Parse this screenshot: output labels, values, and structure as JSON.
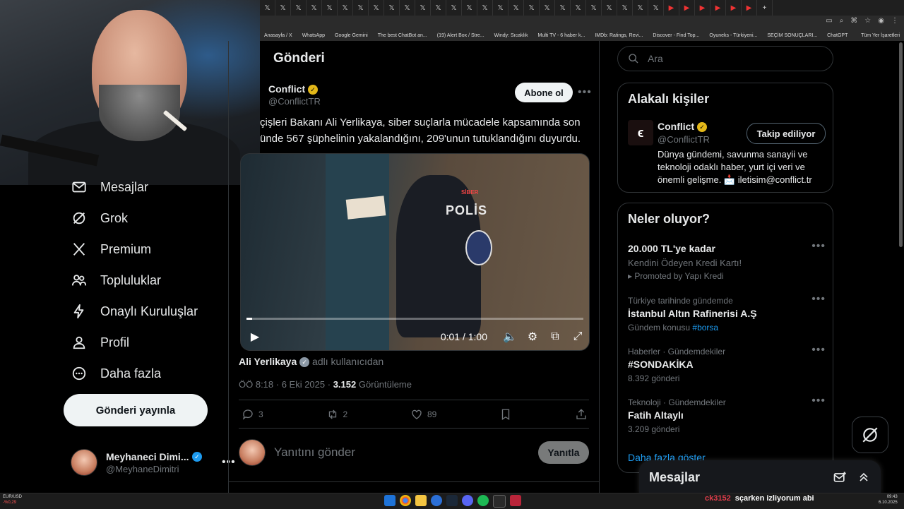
{
  "browser": {
    "tab_glyph": "𝕏",
    "bookmarks": [
      "Anasayfa / X",
      "WhatsApp",
      "Google Gemini",
      "The best ChatBot an...",
      "(19) Alert Box / Stre...",
      "Windy: Sıcaklık",
      "Multi TV - 6 haber k...",
      "IMDb: Ratings, Revi...",
      "Discover - Find Top...",
      "Oyuneks - Türkiyeni...",
      "SEÇİM SONUÇLARI...",
      "ChatGPT"
    ],
    "bookmarks_all": "Tüm Yer İşaretleri"
  },
  "nav": {
    "items": [
      {
        "label": "Mesajlar",
        "icon": "envelope-icon"
      },
      {
        "label": "Grok",
        "icon": "grok-icon"
      },
      {
        "label": "Premium",
        "icon": "x-logo-icon"
      },
      {
        "label": "Topluluklar",
        "icon": "people-icon"
      },
      {
        "label": "Onaylı Kuruluşlar",
        "icon": "lightning-icon"
      },
      {
        "label": "Profil",
        "icon": "person-icon"
      },
      {
        "label": "Daha fazla",
        "icon": "more-circle-icon"
      }
    ],
    "post_button": "Gönderi yayınla",
    "account": {
      "name": "Meyhaneci Dimi...",
      "handle": "@MeyhaneDimitri",
      "more": "•••"
    }
  },
  "main": {
    "title": "Gönderi",
    "author": {
      "name": "Conflict",
      "handle": "@ConflictTR"
    },
    "subscribe": "Abone ol",
    "more": "•••",
    "text": "çişleri Bakanı Ali Yerlikaya, siber suçlarla mücadele kapsamında son\nünde 567 şüphelinin yakalandığını, 209'unun tutuklandığını duyurdu.",
    "video": {
      "time": "0:01 / 1:00",
      "progress": 0.0167,
      "overlay_siber": "SİBER",
      "overlay_police": "POLİS"
    },
    "via": {
      "name": "Ali Yerlikaya",
      "suffix": "adlı kullanıcıdan"
    },
    "meta": {
      "time": "ÖÖ 8:18 · 6 Eki 2025 · ",
      "views": "3.152",
      "views_label": " Görüntüleme"
    },
    "actions": {
      "replies": "3",
      "reposts": "2",
      "likes": "89"
    },
    "reply": {
      "placeholder": "Yanıtını gönder",
      "button": "Yanıtla"
    }
  },
  "sidebar": {
    "search_placeholder": "Ara",
    "related": {
      "title": "Alakalı kişiler",
      "name": "Conflict",
      "handle": "@ConflictTR",
      "follow": "Takip ediliyor",
      "bio": "Dünya gündemi, savunma sanayii ve teknoloji odaklı haber, yurt içi veri ve önemli gelişme. 📩 iletisim@conflict.tr"
    },
    "trends": {
      "title": "Neler oluyor?",
      "promo": {
        "title": "20.000 TL'ye kadar",
        "sub": "Kendini Ödeyen Kredi Kartı!",
        "promoted": "Promoted by Yapı Kredi"
      },
      "items": [
        {
          "meta": "Türkiye tarihinde gündemde",
          "title": "İstanbul Altın Rafinerisi A.Ş",
          "sub": "Gündem konusu",
          "tag": "#borsa"
        },
        {
          "meta": "Haberler · Gündemdekiler",
          "title": "#SONDAKİKA",
          "sub": "8.392 gönderi"
        },
        {
          "meta": "Teknoloji · Gündemdekiler",
          "title": "Fatih Altaylı",
          "sub": "3.209 gönderi"
        }
      ],
      "show_more": "Daha fazla göster"
    },
    "messages_title": "Mesajlar"
  },
  "taskbar": {
    "ticker_pair": "EUR/USD",
    "ticker_change": "-%0,29",
    "chat_user": "ck3152",
    "chat_message": "sçarken izliyorum abi",
    "time": "09:43",
    "date": "6.10.2025"
  },
  "colors": {
    "accent": "#1d9bf0",
    "verified_gold": "#e2b719",
    "bg": "#000000",
    "border": "#2f3336"
  }
}
